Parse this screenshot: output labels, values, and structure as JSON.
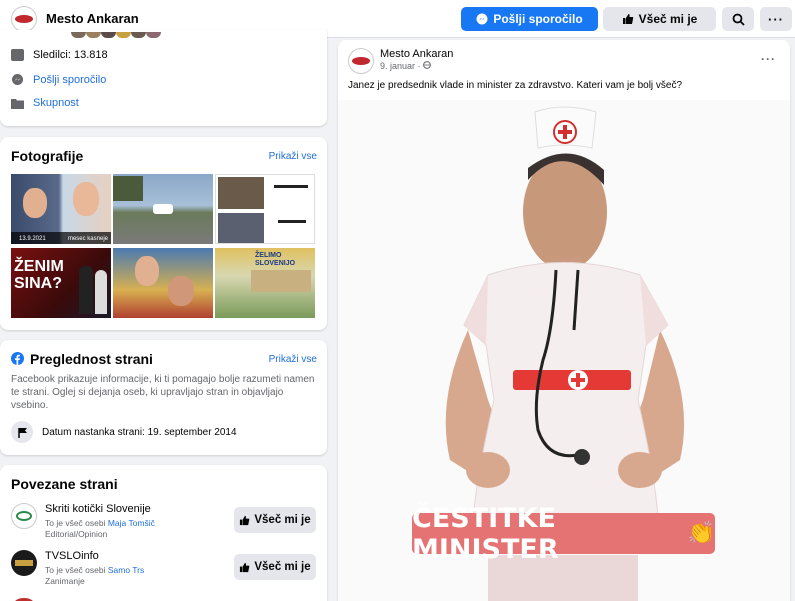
{
  "header": {
    "page_name": "Mesto Ankaran",
    "send_message": "Pošlji sporočilo",
    "like": "Všeč mi je"
  },
  "about": {
    "followers": "Sledilci: 13.818",
    "send_message": "Pošlji sporočilo",
    "category": "Skupnost"
  },
  "photos": {
    "title": "Fotografije",
    "see_all": "Prikaži vse",
    "captions": {
      "p1_date": "13.9.2021",
      "p1_label": "mesec kasneje",
      "p4_text": "ŽENIM SINA?",
      "p6_text": "ŽELIMO SLOVENIJO"
    }
  },
  "transparency": {
    "title": "Preglednost strani",
    "see_all": "Prikaži vse",
    "description": "Facebook prikazuje informacije, ki ti pomagajo bolje razumeti namen te strani. Oglej si dejanja oseb, ki upravljajo stran in objavljajo vsebino.",
    "created": "Datum nastanka strani: 19. september 2014"
  },
  "related": {
    "title": "Povezane strani",
    "items": [
      {
        "name": "Skriti kotički Slovenije",
        "liked_prefix": "To je všeč osebi ",
        "liked_person": "Maja Tomšič",
        "category": "Editorial/Opinion",
        "button": "Všeč mi je"
      },
      {
        "name": "TVSLOinfo",
        "liked_prefix": "To je všeč osebi ",
        "liked_person": "Samo Trs",
        "category": "Zanimanje",
        "button": "Všeč mi je"
      }
    ]
  },
  "post": {
    "author": "Mesto Ankaran",
    "date": "9. januar · ",
    "text": "Janez je predsednik vlade in minister za zdravstvo. Kateri vam je bolj všeč?",
    "banner": "ČESTITKE MINISTER"
  },
  "colors": {
    "brand_blue": "#1877f2",
    "link_blue": "#216fdb",
    "logo_red": "#c0282d",
    "banner_red": "#e57373"
  }
}
